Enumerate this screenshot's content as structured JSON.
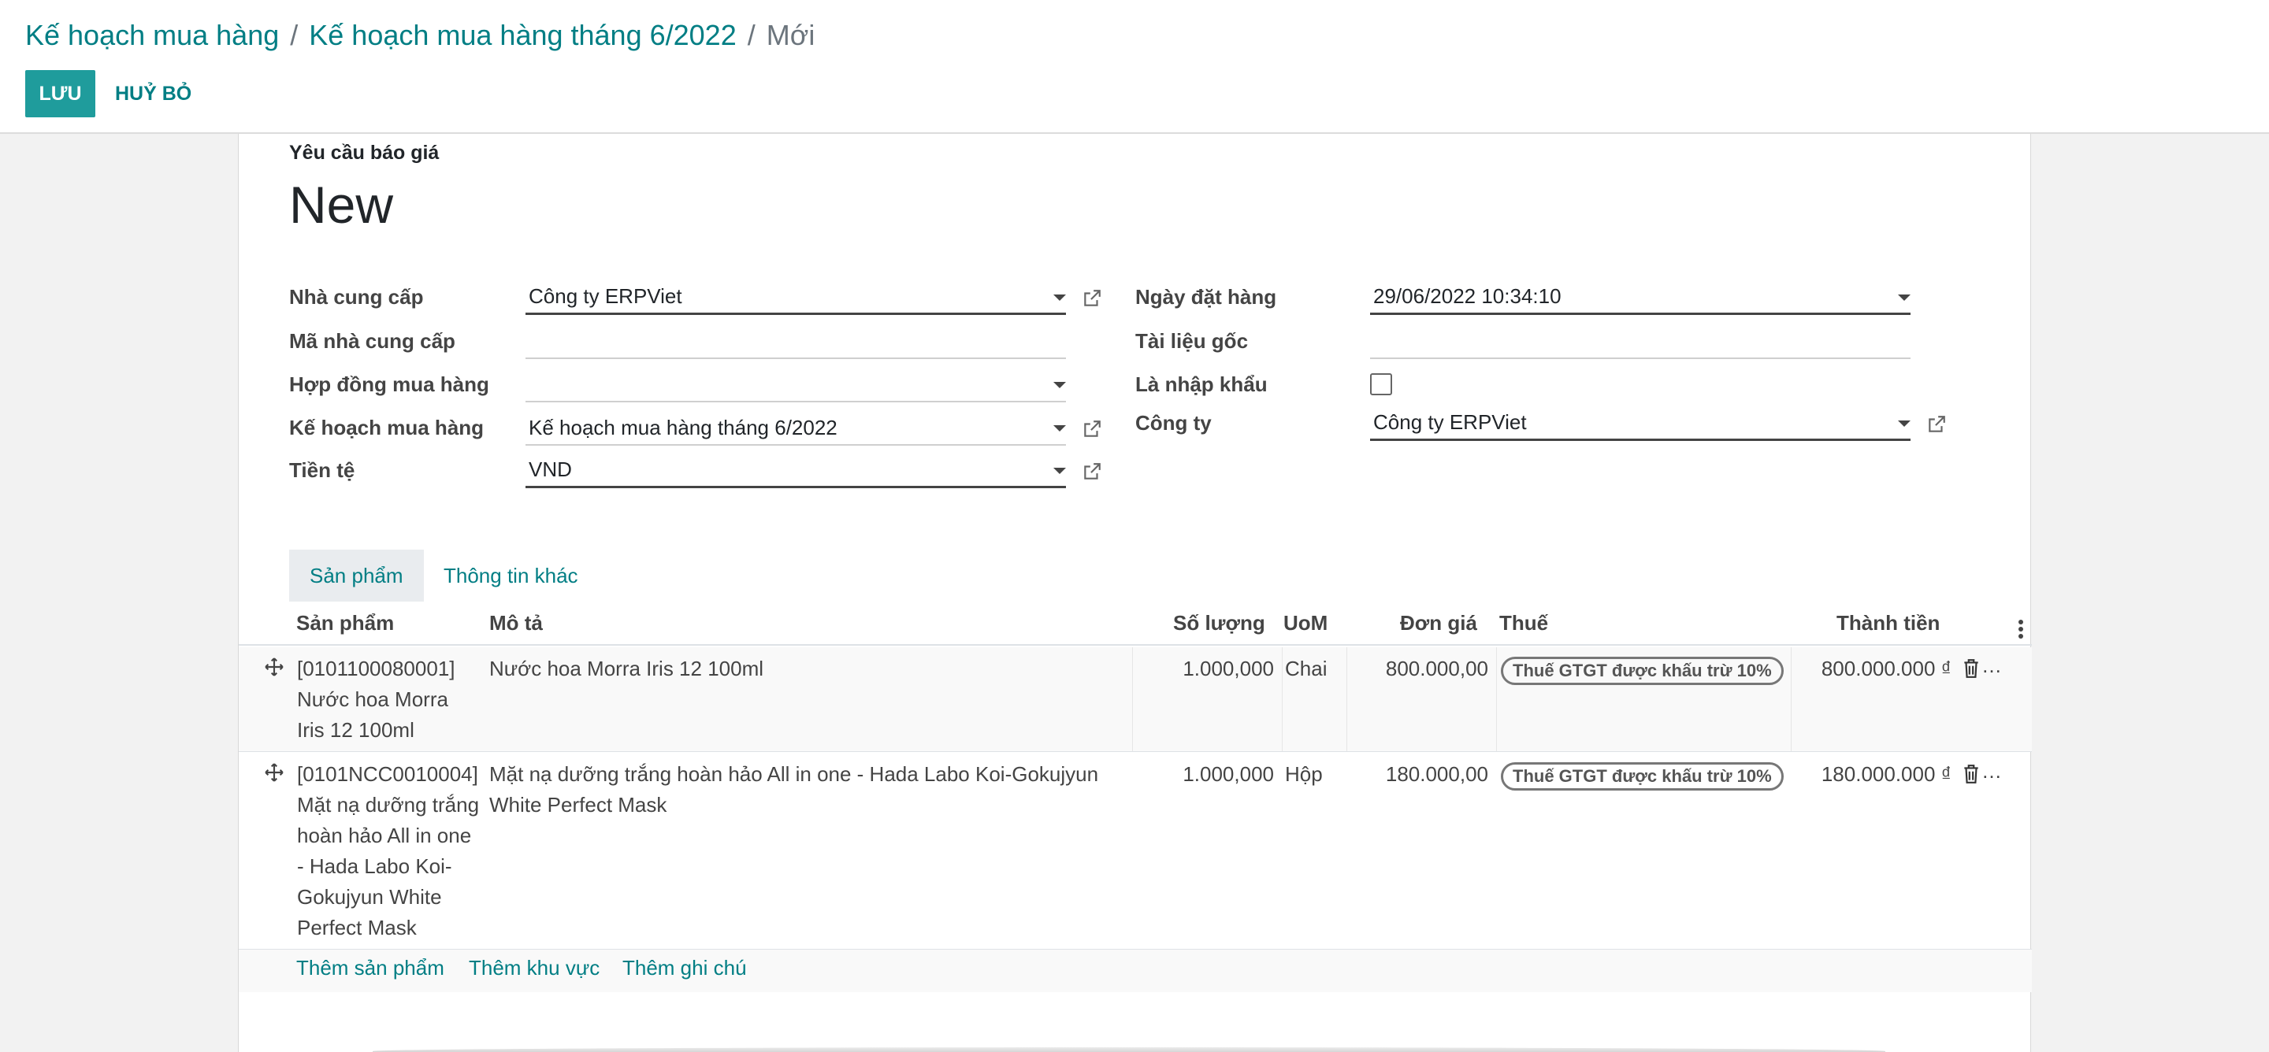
{
  "breadcrumb": {
    "items": [
      "Kế hoạch mua hàng",
      "Kế hoạch mua hàng tháng 6/2022"
    ],
    "separator": "/",
    "current": "Mới"
  },
  "buttons": {
    "save": "LƯU",
    "discard": "HUỶ BỎ"
  },
  "document": {
    "label": "Yêu cầu báo giá",
    "title": "New"
  },
  "fields_left": [
    {
      "label": "Nhà cung cấp",
      "value": "Công ty ERPViet"
    },
    {
      "label": "Mã nhà cung cấp",
      "value": ""
    },
    {
      "label": "Hợp đồng mua hàng",
      "value": ""
    },
    {
      "label": "Kế hoạch mua hàng",
      "value": "Kế hoạch mua hàng tháng 6/2022"
    },
    {
      "label": "Tiền tệ",
      "value": "VND"
    }
  ],
  "fields_right": [
    {
      "label": "Ngày đặt hàng",
      "value": "29/06/2022 10:34:10"
    },
    {
      "label": "Tài liệu gốc",
      "value": ""
    },
    {
      "label": "Là nhập khẩu",
      "value": "",
      "checked": false
    },
    {
      "label": "Công ty",
      "value": "Công ty ERPViet"
    }
  ],
  "tabs": [
    {
      "label": "Sản phẩm",
      "active": true
    },
    {
      "label": "Thông tin khác",
      "active": false
    }
  ],
  "table": {
    "columns": [
      "Sản phẩm",
      "Mô tả",
      "Số lượng",
      "UoM",
      "Đơn giá",
      "Thuế",
      "Thành tiền"
    ],
    "rows": [
      {
        "product": [
          "[0101100080001]",
          "Nước hoa Morra",
          "Iris 12 100ml"
        ],
        "description": [
          "Nước hoa Morra Iris 12 100ml"
        ],
        "quantity": "1.000,000",
        "uom": "Chai",
        "unit_price": "800.000,00",
        "tax": "Thuế GTGT được khấu trừ 10%",
        "subtotal": "800.000.000 ₫"
      },
      {
        "product": [
          "[0101NCC0010004]",
          "Mặt nạ dưỡng trắng",
          "hoàn hảo All in one",
          "- Hada Labo Koi-",
          "Gokujyun White",
          "Perfect Mask"
        ],
        "description": [
          "Mặt nạ dưỡng trắng hoàn hảo All in one - Hada Labo Koi-Gokujyun",
          "White Perfect Mask"
        ],
        "quantity": "1.000,000",
        "uom": "Hộp",
        "unit_price": "180.000,00",
        "tax": "Thuế GTGT được khấu trừ 10%",
        "subtotal": "180.000.000 ₫"
      }
    ]
  },
  "add_links": [
    "Thêm sản phẩm",
    "Thêm khu vực",
    "Thêm ghi chú"
  ],
  "icons": {
    "dropdown": "caret-down-icon",
    "external": "external-link-icon",
    "drag": "drag-handle-icon",
    "delete": "trash-icon",
    "options": "vertical-dots-icon"
  },
  "colors": {
    "primary": "#1f9c9c",
    "link": "#017e84"
  }
}
